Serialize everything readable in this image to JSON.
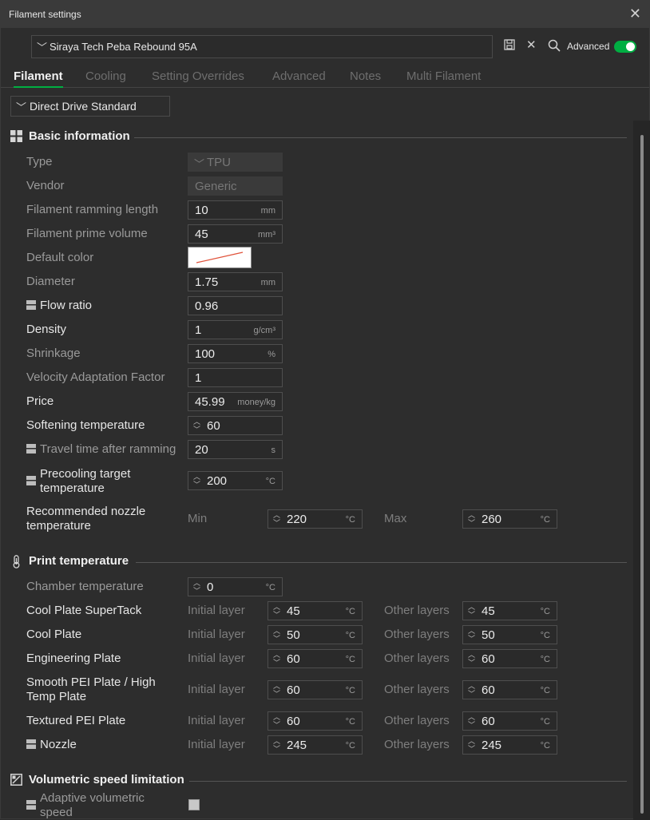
{
  "window": {
    "title": "Filament settings"
  },
  "preset": {
    "name": "Siraya Tech Peba Rebound 95A"
  },
  "toolbar": {
    "advanced_label": "Advanced",
    "advanced_on": true
  },
  "tabs": [
    "Filament",
    "Cooling",
    "Setting Overrides",
    "Advanced",
    "Notes",
    "Multi Filament"
  ],
  "active_tab": "Filament",
  "extruder": {
    "selected": "Direct Drive Standard"
  },
  "basic": {
    "title": "Basic information",
    "type_label": "Type",
    "type_value": "TPU",
    "vendor_label": "Vendor",
    "vendor_value": "Generic",
    "ramming_label": "Filament ramming length",
    "ramming_value": "10",
    "ramming_unit": "mm",
    "prime_label": "Filament prime volume",
    "prime_value": "45",
    "prime_unit": "mm³",
    "color_label": "Default color",
    "diameter_label": "Diameter",
    "diameter_value": "1.75",
    "diameter_unit": "mm",
    "flow_label": "Flow ratio",
    "flow_value": "0.96",
    "density_label": "Density",
    "density_value": "1",
    "density_unit": "g/cm³",
    "shrink_label": "Shrinkage",
    "shrink_value": "100",
    "shrink_unit": "%",
    "vaf_label": "Velocity Adaptation Factor",
    "vaf_value": "1",
    "price_label": "Price",
    "price_value": "45.99",
    "price_unit": "money/kg",
    "soft_label": "Softening temperature",
    "soft_value": "60",
    "travel_label": "Travel time after ramming",
    "travel_value": "20",
    "travel_unit": "s",
    "precool_label_1": "Precooling target",
    "precool_label_2": "temperature",
    "precool_value": "200",
    "precool_unit": "°C",
    "nozzle_rec_label_1": "Recommended nozzle",
    "nozzle_rec_label_2": "temperature",
    "min_label": "Min",
    "min_value": "220",
    "max_label": "Max",
    "max_value": "260",
    "temp_unit": "°C"
  },
  "print_temp": {
    "title": "Print temperature",
    "chamber_label": "Chamber temperature",
    "chamber_value": "0",
    "initial_label": "Initial layer",
    "other_label": "Other layers",
    "unit": "°C",
    "rows": [
      {
        "label": "Cool Plate SuperTack",
        "initial": "45",
        "other": "45"
      },
      {
        "label": "Cool Plate",
        "initial": "50",
        "other": "50"
      },
      {
        "label": "Engineering Plate",
        "initial": "60",
        "other": "60"
      },
      {
        "label_1": "Smooth PEI Plate / High",
        "label_2": "Temp Plate",
        "initial": "60",
        "other": "60"
      },
      {
        "label": "Textured PEI Plate",
        "initial": "60",
        "other": "60"
      },
      {
        "label": "Nozzle",
        "initial": "245",
        "other": "245"
      }
    ]
  },
  "volumetric": {
    "title": "Volumetric speed limitation",
    "adaptive_label_1": "Adaptive volumetric",
    "adaptive_label_2": "speed",
    "adaptive_checked": false
  },
  "colors": {
    "accent": "#00ae42",
    "background": "#2d2d2d"
  }
}
